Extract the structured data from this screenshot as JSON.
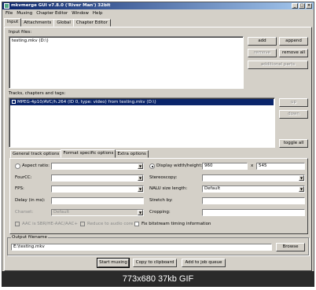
{
  "window": {
    "title": "mkvmerge GUI v7.8.0 ('River Man') 32bit"
  },
  "menu": [
    "File",
    "Muxing",
    "Chapter Editor",
    "Window",
    "Help"
  ],
  "tabs": [
    "Input",
    "Attachments",
    "Global",
    "Chapter Editor"
  ],
  "input_files": {
    "label": "Input files:",
    "items": [
      "testing.mkv (D:\\)"
    ],
    "buttons": {
      "add": "add",
      "append": "append",
      "remove": "remove",
      "remove_all": "remove all",
      "additional_parts": "additional parts"
    }
  },
  "tracks": {
    "label": "Tracks, chapters and tags:",
    "items": [
      "MPEG-4p10/AVC/h.264 (ID 0, type: video) from testing.mkv (D:\\)"
    ],
    "buttons": {
      "up": "up",
      "down": "down",
      "toggle_all": "toggle all"
    }
  },
  "options_tabs": [
    "General track options",
    "Format specific options",
    "Extra options"
  ],
  "format": {
    "aspect_ratio": "Aspect ratio:",
    "display_wh": "Display width/height:",
    "width": "960",
    "x": "x",
    "height": "545",
    "fourcc": "FourCC:",
    "stereoscopy": "Stereoscopy:",
    "fps": "FPS:",
    "nalu": "NALU size length:",
    "nalu_value": "Default",
    "delay": "Delay (in ms):",
    "stretch": "Stretch by:",
    "charset": "Charset:",
    "charset_value": "Default",
    "cropping": "Cropping:",
    "aac": "AAC is SBR/HE-AAC/AAC+",
    "reduce": "Reduce to audio core",
    "fix_timing": "Fix bitstream timing information"
  },
  "output": {
    "label": "Output filename",
    "value": "E:\\testing.mkv",
    "browse": "Browse"
  },
  "actions": {
    "start": "Start muxing",
    "copy": "Copy to clipboard",
    "add_job": "Add to job queue"
  },
  "footer": "773x680  37kb  GIF"
}
